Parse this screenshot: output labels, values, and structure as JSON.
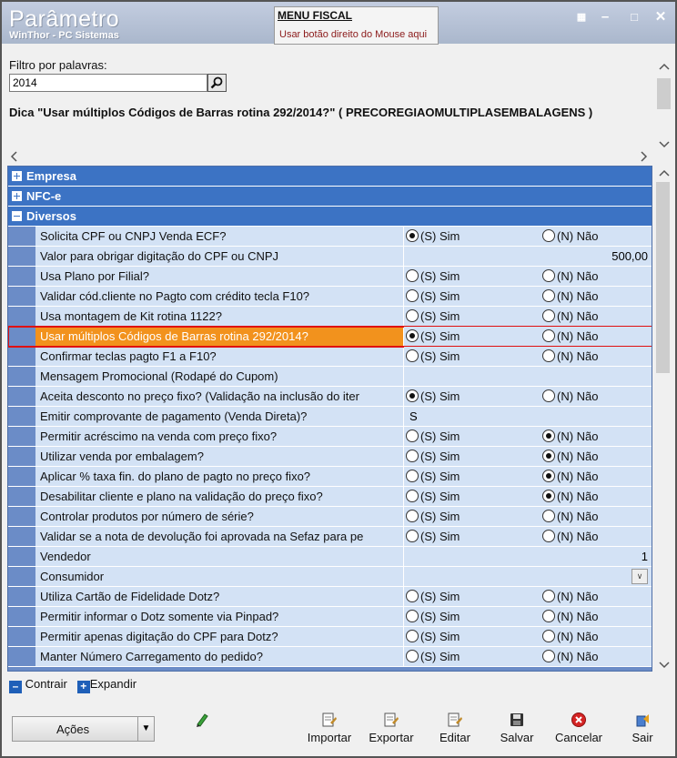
{
  "window": {
    "title": "Parâmetro",
    "subtitle": "WinThor - PC Sistemas",
    "menu_fiscal_title": "MENU FISCAL",
    "menu_fiscal_hint": "Usar botão direito do Mouse aqui"
  },
  "filter": {
    "label": "Filtro por palavras:",
    "value": "2014"
  },
  "tip": "Dica \"Usar múltiplos Códigos de Barras rotina 292/2014?\" ( PRECOREGIAOMULTIPLASEMBALAGENS )",
  "groups": {
    "empresa": "Empresa",
    "nfce": "NFC-e",
    "diversos": "Diversos"
  },
  "options": {
    "sim": "(S) Sim",
    "nao": "(N) Não"
  },
  "rows": [
    {
      "label": "Solicita CPF ou CNPJ Venda ECF?",
      "type": "radio",
      "value": "S"
    },
    {
      "label": "Valor para obrigar digitação do CPF ou CNPJ",
      "type": "number",
      "value": "500,00"
    },
    {
      "label": "Usa Plano por Filial?",
      "type": "radio",
      "value": ""
    },
    {
      "label": "Validar cód.cliente no Pagto com crédito tecla F10?",
      "type": "radio",
      "value": ""
    },
    {
      "label": "Usa montagem de Kit rotina 1122?",
      "type": "radio",
      "value": ""
    },
    {
      "label": "Usar múltiplos Códigos de Barras rotina 292/2014?",
      "type": "radio",
      "value": "S",
      "selected": true
    },
    {
      "label": "Confirmar teclas pagto F1 a F10?",
      "type": "radio",
      "value": ""
    },
    {
      "label": "Mensagem Promocional (Rodapé do Cupom)",
      "type": "text",
      "value": ""
    },
    {
      "label": "Aceita desconto no preço fixo? (Validação na inclusão do iter",
      "type": "radio",
      "value": "S"
    },
    {
      "label": "Emitir comprovante de pagamento (Venda Direta)?",
      "type": "text",
      "value": "S"
    },
    {
      "label": "Permitir acréscimo na venda com preço fixo?",
      "type": "radio",
      "value": "N"
    },
    {
      "label": "Utilizar venda por embalagem?",
      "type": "radio",
      "value": "N"
    },
    {
      "label": "Aplicar % taxa fin. do plano de pagto no preço fixo?",
      "type": "radio",
      "value": "N"
    },
    {
      "label": "Desabilitar cliente e plano na validação do preço fixo?",
      "type": "radio",
      "value": "N"
    },
    {
      "label": "Controlar produtos por número de série?",
      "type": "radio",
      "value": ""
    },
    {
      "label": "Validar se a nota de devolução foi aprovada na Sefaz para pe",
      "type": "radio",
      "value": ""
    },
    {
      "label": "Vendedor",
      "type": "number",
      "value": "1"
    },
    {
      "label": "Consumidor",
      "type": "combo",
      "value": ""
    },
    {
      "label": "Utiliza Cartão de Fidelidade Dotz?",
      "type": "radio",
      "value": ""
    },
    {
      "label": "Permitir informar o Dotz somente via Pinpad?",
      "type": "radio",
      "value": ""
    },
    {
      "label": "Permitir apenas digitação do CPF para Dotz?",
      "type": "radio",
      "value": ""
    },
    {
      "label": "Manter Número Carregamento do pedido?",
      "type": "radio",
      "value": ""
    }
  ],
  "tree_actions": {
    "collapse": "Contrair",
    "expand": "Expandir"
  },
  "toolbar": {
    "actions": "Ações",
    "import": "Importar",
    "export": "Exportar",
    "edit": "Editar",
    "save": "Salvar",
    "cancel": "Cancelar",
    "exit": "Sair"
  },
  "colors": {
    "group_header": "#3c73c4",
    "row_bg": "#d3e2f5",
    "selected_row": "#f2921d",
    "highlight_border": "#e01010"
  }
}
